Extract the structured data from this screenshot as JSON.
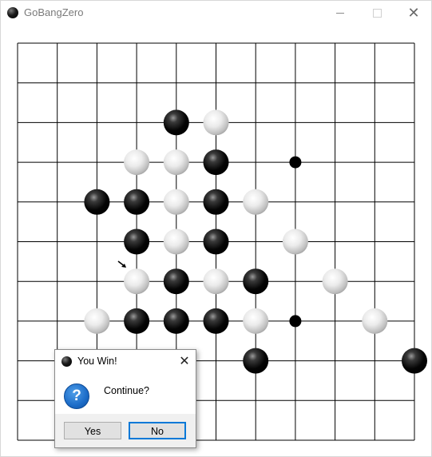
{
  "window": {
    "title": "GoBangZero",
    "controls": {
      "minimize": "minimize",
      "maximize": "maximize",
      "close": "✕"
    }
  },
  "board": {
    "grid_size": 11,
    "star_points": [
      [
        7,
        3
      ],
      [
        7,
        7
      ]
    ],
    "stones": [
      {
        "color": "black",
        "col": 4,
        "row": 2
      },
      {
        "color": "white",
        "col": 5,
        "row": 2
      },
      {
        "color": "white",
        "col": 3,
        "row": 3
      },
      {
        "color": "white",
        "col": 4,
        "row": 3
      },
      {
        "color": "black",
        "col": 5,
        "row": 3
      },
      {
        "color": "black",
        "col": 2,
        "row": 4
      },
      {
        "color": "black",
        "col": 3,
        "row": 4
      },
      {
        "color": "white",
        "col": 4,
        "row": 4
      },
      {
        "color": "black",
        "col": 5,
        "row": 4
      },
      {
        "color": "white",
        "col": 6,
        "row": 4
      },
      {
        "color": "black",
        "col": 3,
        "row": 5
      },
      {
        "color": "white",
        "col": 4,
        "row": 5
      },
      {
        "color": "black",
        "col": 5,
        "row": 5
      },
      {
        "color": "white",
        "col": 7,
        "row": 5
      },
      {
        "color": "white",
        "col": 3,
        "row": 6
      },
      {
        "color": "black",
        "col": 4,
        "row": 6
      },
      {
        "color": "white",
        "col": 5,
        "row": 6
      },
      {
        "color": "black",
        "col": 6,
        "row": 6
      },
      {
        "color": "white",
        "col": 8,
        "row": 6
      },
      {
        "color": "white",
        "col": 2,
        "row": 7
      },
      {
        "color": "black",
        "col": 3,
        "row": 7
      },
      {
        "color": "black",
        "col": 4,
        "row": 7
      },
      {
        "color": "black",
        "col": 5,
        "row": 7
      },
      {
        "color": "white",
        "col": 6,
        "row": 7
      },
      {
        "color": "white",
        "col": 9,
        "row": 7
      },
      {
        "color": "black",
        "col": 6,
        "row": 8
      },
      {
        "color": "black",
        "col": 10,
        "row": 8
      }
    ]
  },
  "dialog": {
    "title": "You Win!",
    "close": "✕",
    "icon": "?",
    "message": "Continue?",
    "yes_label": "Yes",
    "no_label": "No"
  },
  "colors": {
    "grid_line": "#000000",
    "dialog_bg": "#f0f0f0",
    "focus": "#0078d7",
    "question_blue": "#1c6cc8"
  }
}
